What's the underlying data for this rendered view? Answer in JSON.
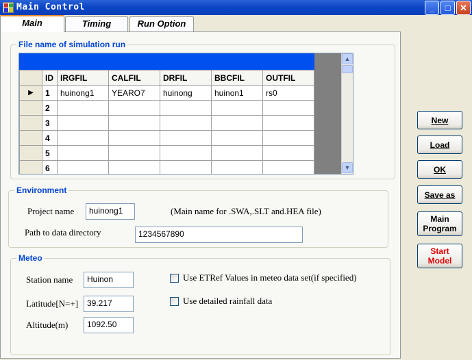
{
  "window": {
    "title": "Main Control"
  },
  "tabs": [
    {
      "label": "Main"
    },
    {
      "label": "Timing"
    },
    {
      "label": "Run Option"
    }
  ],
  "simulation": {
    "legend": "File name of simulation run",
    "columns": [
      "ID",
      "IRGFIL",
      "CALFIL",
      "DRFIL",
      "BBCFIL",
      "OUTFIL"
    ],
    "rows": [
      {
        "id": "1",
        "irgfil": "huinong1",
        "calfil": "YEARO7",
        "drfil": "huinong",
        "bbcfil": "huinon1",
        "outfil": "rs0"
      },
      {
        "id": "2",
        "irgfil": "",
        "calfil": "",
        "drfil": "",
        "bbcfil": "",
        "outfil": ""
      },
      {
        "id": "3",
        "irgfil": "",
        "calfil": "",
        "drfil": "",
        "bbcfil": "",
        "outfil": ""
      },
      {
        "id": "4",
        "irgfil": "",
        "calfil": "",
        "drfil": "",
        "bbcfil": "",
        "outfil": ""
      },
      {
        "id": "5",
        "irgfil": "",
        "calfil": "",
        "drfil": "",
        "bbcfil": "",
        "outfil": ""
      },
      {
        "id": "6",
        "irgfil": "",
        "calfil": "",
        "drfil": "",
        "bbcfil": "",
        "outfil": ""
      }
    ],
    "current_row_marker": "▶"
  },
  "environment": {
    "legend": "Environment",
    "project_name_label": "Project name",
    "project_name_value": "huinong1",
    "project_name_hint": "(Main name for .SWA,.SLT and.HEA file)",
    "path_label": "Path to data directory",
    "path_value": "1234567890"
  },
  "meteo": {
    "legend": "Meteo",
    "station_label": "Station name",
    "station_value": "Huinon",
    "latitude_label": "Latitude[N=+]",
    "latitude_value": "39.217",
    "altitude_label": "Altitude(m)",
    "altitude_value": "1092.50",
    "etref_label": "Use ETRef Values in meteo data set(if specified)",
    "etref_checked": false,
    "rainfall_label": "Use detailed rainfall data",
    "rainfall_checked": false
  },
  "actions": {
    "new": "New",
    "load": "Load",
    "ok": "OK",
    "save_as": "Save as",
    "main_program": "Main Program",
    "start_model": "Start Model"
  },
  "colors": {
    "title_bar": "#0a44c4",
    "grid_caption": "#0050f0",
    "legend_text": "#0046d5",
    "start_model_text": "#e00000"
  }
}
